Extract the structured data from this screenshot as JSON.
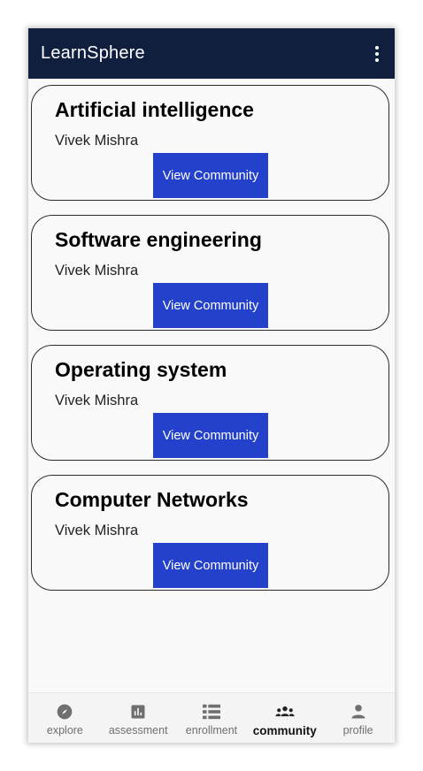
{
  "app": {
    "title": "LearnSphere"
  },
  "communities": [
    {
      "title": "Artificial intelligence",
      "author": "Vivek Mishra",
      "button": "View Community"
    },
    {
      "title": "Software engineering",
      "author": "Vivek Mishra",
      "button": "View Community"
    },
    {
      "title": "Operating system",
      "author": "Vivek Mishra",
      "button": "View Community"
    },
    {
      "title": "Computer Networks",
      "author": "Vivek Mishra",
      "button": "View Community"
    }
  ],
  "nav": {
    "items": [
      {
        "label": "explore",
        "icon": "compass-icon"
      },
      {
        "label": "assessment",
        "icon": "bar-chart-icon"
      },
      {
        "label": "enrollment",
        "icon": "list-icon"
      },
      {
        "label": "community",
        "icon": "people-icon"
      },
      {
        "label": "profile",
        "icon": "person-icon"
      }
    ],
    "active": "community"
  },
  "colors": {
    "appbar": "#0f1f3d",
    "button": "#2441cc",
    "background": "#f9f9f9"
  }
}
